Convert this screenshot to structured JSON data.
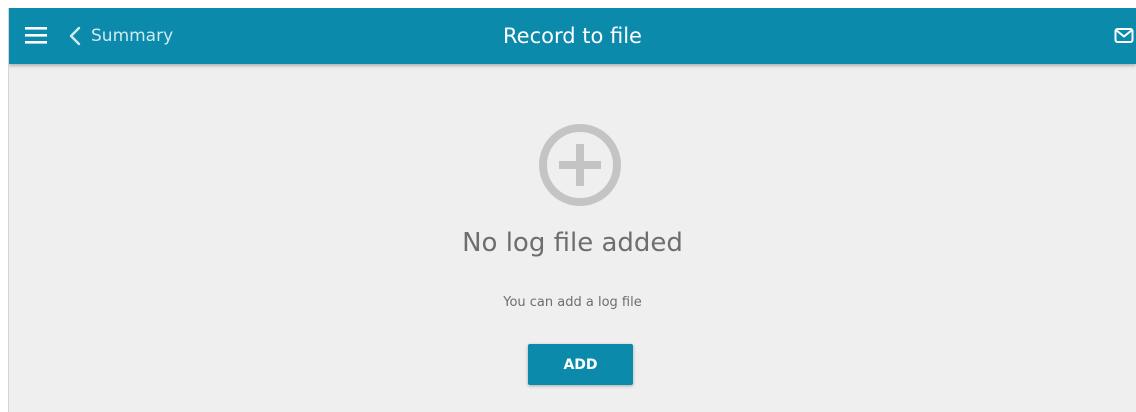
{
  "header": {
    "back_label": "Summary",
    "title": "Record to file",
    "menu_icon": "hamburger-menu-icon",
    "back_icon": "chevron-left-icon",
    "mail_icon": "envelope-icon"
  },
  "empty_state": {
    "icon": "plus-circle-icon",
    "title": "No log file added",
    "subtitle": "You can add a log file",
    "add_button_label": "ADD"
  },
  "colors": {
    "accent": "#0b8aac",
    "background": "#efefef",
    "text_muted": "#6e6e6e",
    "icon_gray": "#c4c4c4"
  }
}
